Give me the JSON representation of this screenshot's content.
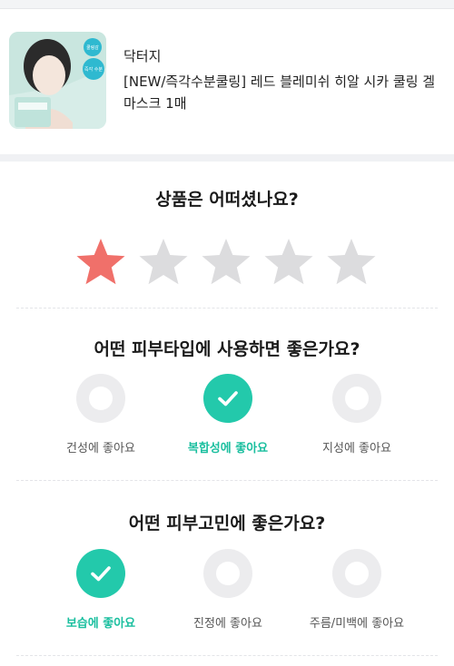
{
  "product": {
    "brand": "닥터지",
    "name": "[NEW/즉각수분쿨링] 레드 블레미쉬 히알 시카 쿨링 겔 마스크 1매",
    "badge1": "쿨링감",
    "badge2": "즉각 수분"
  },
  "rating": {
    "question": "상품은 어떠셨나요?",
    "value": 1,
    "max": 5,
    "active_color": "#f0706a",
    "inactive_color": "#dcdcde"
  },
  "skin_type": {
    "question": "어떤 피부타입에 사용하면 좋은가요?",
    "options": [
      {
        "label": "건성에 좋아요",
        "selected": false
      },
      {
        "label": "복합성에 좋아요",
        "selected": true
      },
      {
        "label": "지성에 좋아요",
        "selected": false
      }
    ]
  },
  "skin_concern": {
    "question": "어떤 피부고민에 좋은가요?",
    "options": [
      {
        "label": "보습에 좋아요",
        "selected": true
      },
      {
        "label": "진정에 좋아요",
        "selected": false
      },
      {
        "label": "주름/미백에 좋아요",
        "selected": false
      }
    ]
  },
  "colors": {
    "accent": "#23c9ab",
    "accent_text": "#1bbf9f"
  }
}
